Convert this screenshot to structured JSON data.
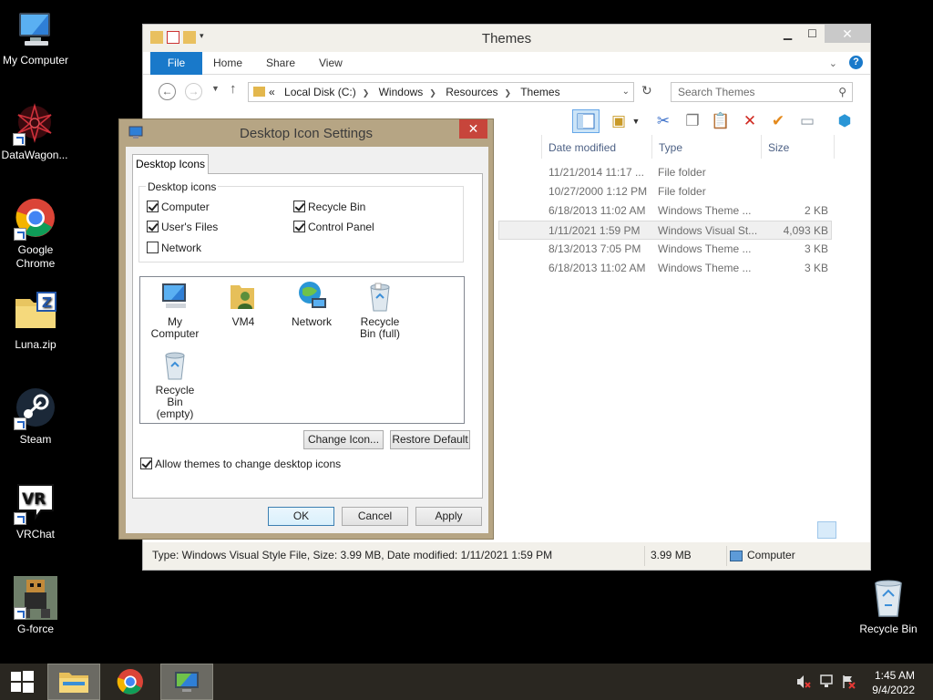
{
  "desktop": {
    "icons": [
      {
        "label": "My Computer"
      },
      {
        "label": "DataWagon..."
      },
      {
        "label": "Google Chrome"
      },
      {
        "label": "Luna.zip"
      },
      {
        "label": "Steam"
      },
      {
        "label": "VRChat"
      },
      {
        "label": "G-force"
      },
      {
        "label": "Recycle Bin"
      }
    ]
  },
  "explorer": {
    "title": "Themes",
    "ribbon": {
      "file": "File",
      "home": "Home",
      "share": "Share",
      "view": "View",
      "help": "?"
    },
    "address": {
      "prefix": "«",
      "crumbs": [
        "Local Disk (C:)",
        "Windows",
        "Resources",
        "Themes"
      ]
    },
    "search_placeholder": "Search Themes",
    "columns": {
      "date": "Date modified",
      "type": "Type",
      "size": "Size"
    },
    "rows": [
      {
        "date": "11/21/2014 11:17 ...",
        "type": "File folder",
        "size": ""
      },
      {
        "date": "10/27/2000 1:12 PM",
        "type": "File folder",
        "size": ""
      },
      {
        "date": "6/18/2013 11:02 AM",
        "type": "Windows Theme ...",
        "size": "2 KB"
      },
      {
        "date": "1/11/2021 1:59 PM",
        "type": "Windows Visual St...",
        "size": "4,093 KB"
      },
      {
        "date": "8/13/2013 7:05 PM",
        "type": "Windows Theme ...",
        "size": "3 KB"
      },
      {
        "date": "6/18/2013 11:02 AM",
        "type": "Windows Theme ...",
        "size": "3 KB"
      }
    ],
    "status": {
      "details": "Type: Windows Visual Style File, Size: 3.99 MB, Date modified: 1/11/2021 1:59 PM",
      "size": "3.99 MB",
      "location": "Computer"
    }
  },
  "dialog": {
    "title": "Desktop Icon Settings",
    "tab": "Desktop Icons",
    "group_label": "Desktop icons",
    "checkboxes": [
      {
        "label": "Computer",
        "checked": true
      },
      {
        "label": "Recycle Bin",
        "checked": true
      },
      {
        "label": "User's Files",
        "checked": true
      },
      {
        "label": "Control Panel",
        "checked": true
      },
      {
        "label": "Network",
        "checked": false
      }
    ],
    "icons": [
      {
        "label": "My Computer"
      },
      {
        "label": "VM4"
      },
      {
        "label": "Network"
      },
      {
        "label": "Recycle Bin (full)"
      },
      {
        "label": "Recycle Bin (empty)"
      }
    ],
    "change_icon": "Change Icon...",
    "restore_default": "Restore Default",
    "allow_themes": {
      "label": "Allow themes to change desktop icons",
      "checked": true
    },
    "ok": "OK",
    "cancel": "Cancel",
    "apply": "Apply"
  },
  "taskbar": {
    "time": "1:45 AM",
    "date": "9/4/2022"
  }
}
